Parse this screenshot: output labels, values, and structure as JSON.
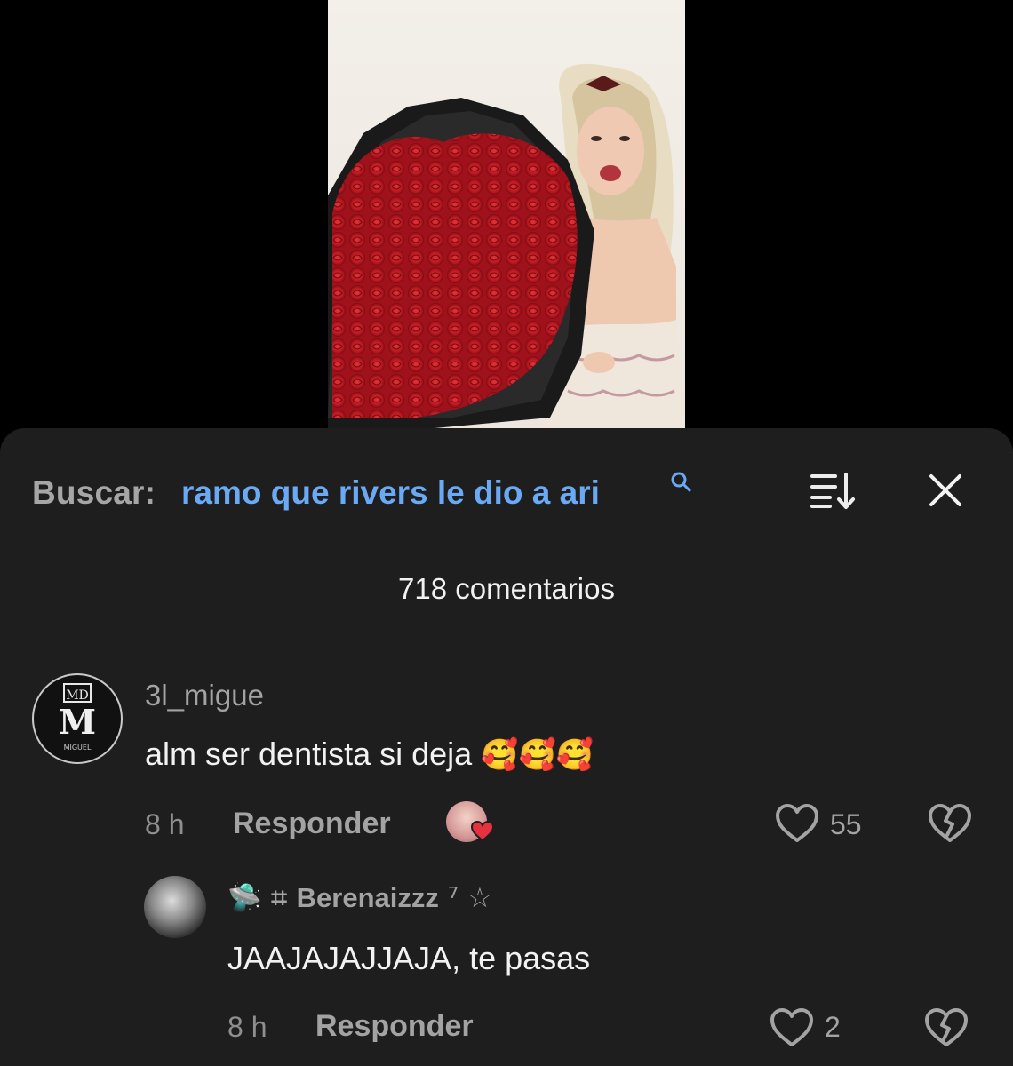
{
  "video": {
    "description_icon": "video-thumbnail"
  },
  "search": {
    "label": "Buscar:",
    "query": "ramo que rivers le dio a ari"
  },
  "comments_count": "718 comentarios",
  "comments": [
    {
      "username": "3l_migue",
      "avatar_text": "MIGUEL",
      "text": "alm ser dentista si deja",
      "emojis": "🥰🥰🥰",
      "time": "8 h",
      "reply_label": "Responder",
      "likes": "55",
      "creator_liked": true
    },
    {
      "username_prefix": "🛸 ⌗ ",
      "username": "Berenaizzz",
      "username_suffix": " ⁷ ☆",
      "text": "JAAJAJAJJAJA, te pasas",
      "time": "8 h",
      "reply_label": "Responder",
      "likes": "2"
    }
  ],
  "colors": {
    "sheet": "#1e1e1e",
    "query": "#6aa9f4",
    "muted": "#a3a3a3"
  }
}
